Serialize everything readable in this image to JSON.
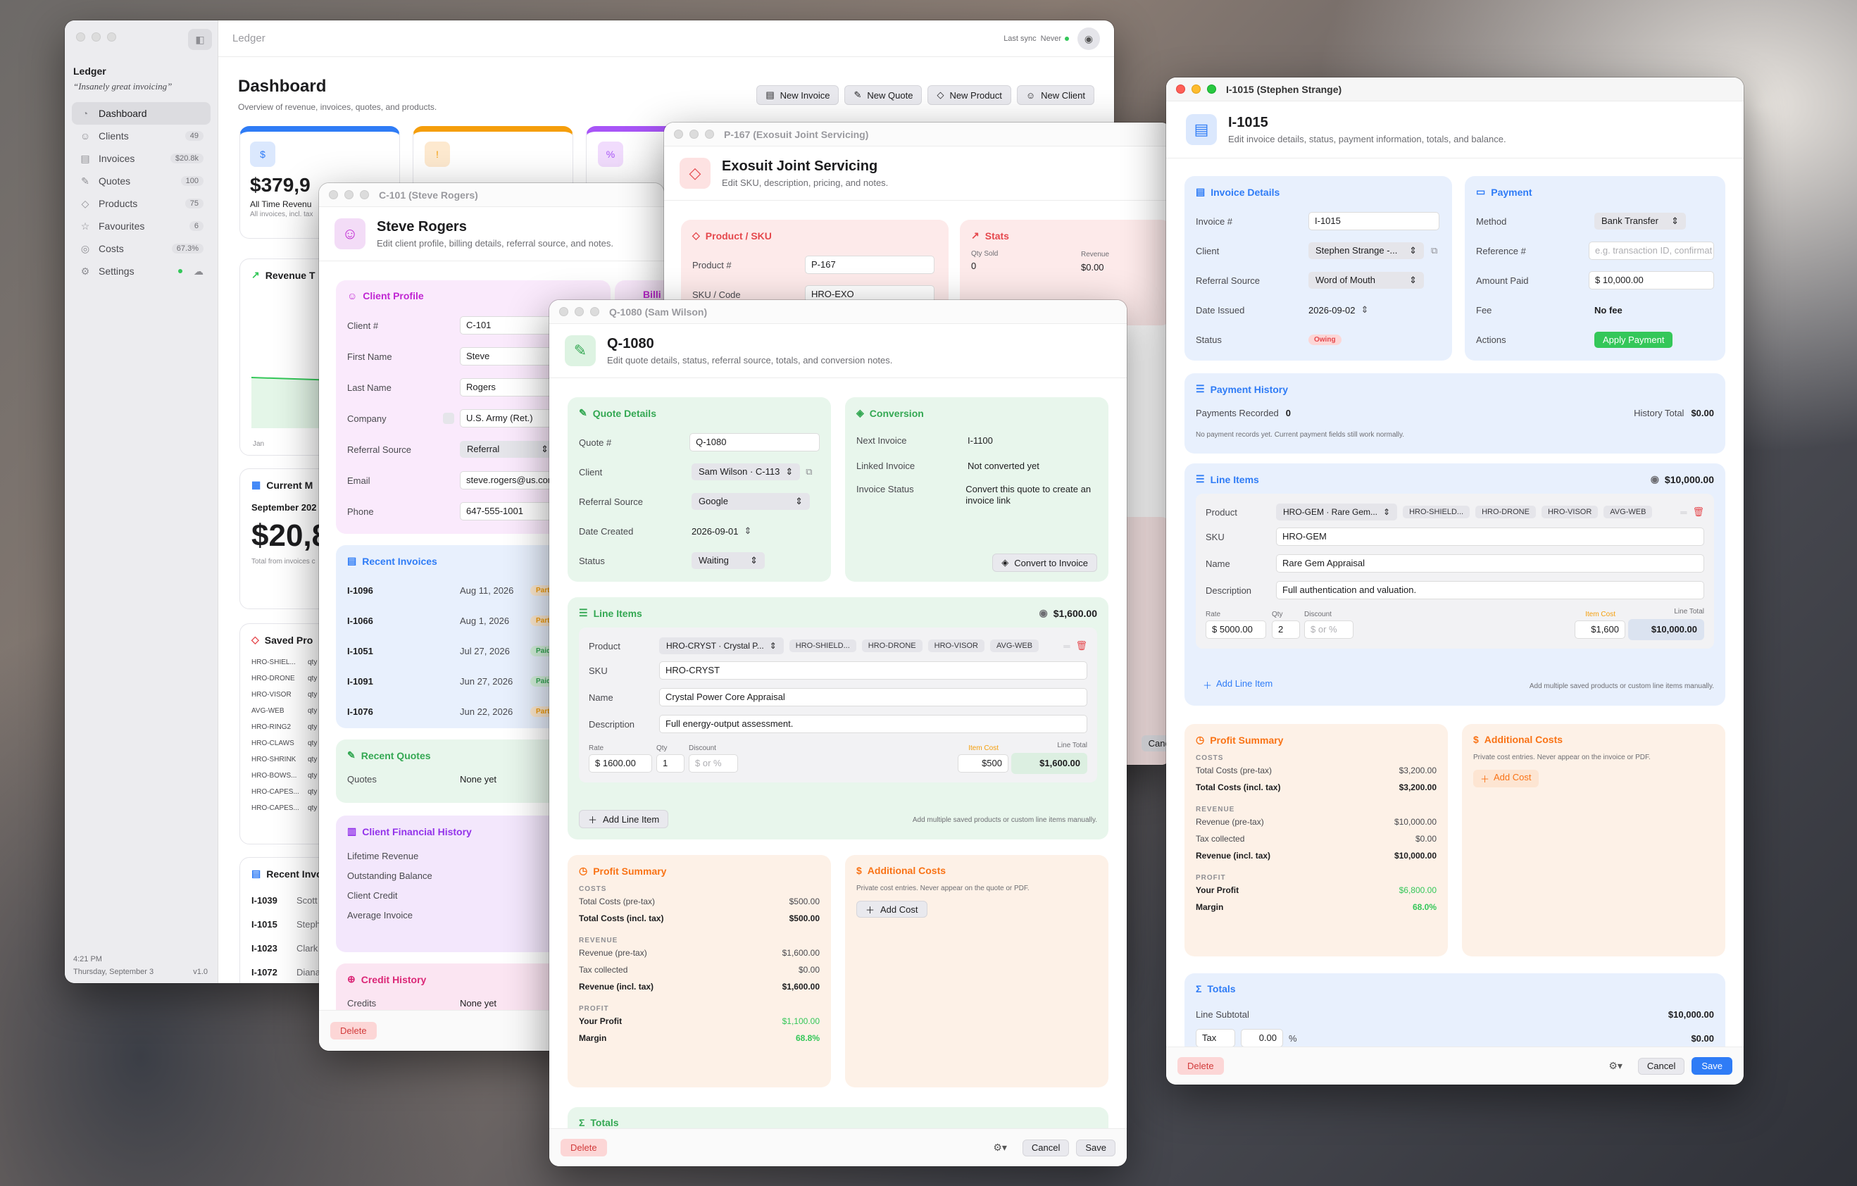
{
  "colors": {
    "accent": "#2f7cf6",
    "success": "#34c759",
    "danger": "#e5484d",
    "warning": "#f59e0b"
  },
  "dash": {
    "title_bar": "Ledger",
    "sync_label": "Last sync",
    "sync_value": "Never",
    "app_name": "Ledger",
    "tagline": "“Insanely great invoicing”",
    "nav": [
      {
        "label": "Dashboard",
        "icon": "gauge-icon",
        "count": ""
      },
      {
        "label": "Clients",
        "icon": "people-icon",
        "count": "49"
      },
      {
        "label": "Invoices",
        "icon": "document-icon",
        "count": "$20.8k"
      },
      {
        "label": "Quotes",
        "icon": "quote-icon",
        "count": "100"
      },
      {
        "label": "Products",
        "icon": "tag-icon",
        "count": "75"
      },
      {
        "label": "Favourites",
        "icon": "star-icon",
        "count": "6"
      },
      {
        "label": "Costs",
        "icon": "coins-icon",
        "count": "67.3%"
      },
      {
        "label": "Settings",
        "icon": "gear-icon",
        "count": ""
      }
    ],
    "time": "4:21 PM",
    "date": "Thursday, September 3",
    "version": "v1.0",
    "page_title": "Dashboard",
    "page_sub": "Overview of revenue, invoices, quotes, and products.",
    "actions": [
      "New Invoice",
      "New Quote",
      "New Product",
      "New Client"
    ],
    "stat_value": "$379,9",
    "stat_label": "All Time Revenu",
    "stat_note": "All invoices, incl. tax",
    "revenue_title": "Revenue T",
    "revenue_axis": "Jan",
    "current_title": "Current M",
    "current_month": "September 202",
    "current_value": "$20,8",
    "current_note": "Total from invoices c",
    "saved_title": "Saved Pro",
    "saved_items": [
      "HRO-SHIEL...",
      "HRO-DRONE",
      "HRO-VISOR",
      "AVG-WEB",
      "HRO-RING2",
      "HRO-CLAWS",
      "HRO-SHRINK",
      "HRO-BOWS...",
      "HRO-CAPES...",
      "HRO-CAPES..."
    ],
    "saved_qty": "qty",
    "recent_title": "Recent Invo",
    "recent": [
      {
        "id": "I-1039",
        "name": "Scott L"
      },
      {
        "id": "I-1015",
        "name": "Stephen"
      },
      {
        "id": "I-1023",
        "name": "Clark K"
      },
      {
        "id": "I-1072",
        "name": "Diana P"
      }
    ]
  },
  "client": {
    "title_bar": "C-101 (Steve Rogers)",
    "name": "Steve Rogers",
    "sub": "Edit client profile, billing details, referral source, and notes.",
    "profile_title": "Client Profile",
    "billing_peek": "Billi",
    "fields": [
      {
        "label": "Client #",
        "value": "C-101"
      },
      {
        "label": "First Name",
        "value": "Steve"
      },
      {
        "label": "Last Name",
        "value": "Rogers"
      },
      {
        "label": "Company",
        "value": "U.S. Army (Ret.)"
      },
      {
        "label": "Referral Source",
        "value": "Referral"
      },
      {
        "label": "Email",
        "value": "steve.rogers@us.com"
      },
      {
        "label": "Phone",
        "value": "647-555-1001"
      }
    ],
    "recent_invoices_title": "Recent Invoices",
    "invoices": [
      {
        "id": "I-1096",
        "date": "Aug 11, 2026",
        "status": "Partial"
      },
      {
        "id": "I-1066",
        "date": "Aug 1, 2026",
        "status": "Partial"
      },
      {
        "id": "I-1051",
        "date": "Jul 27, 2026",
        "status": "Paid"
      },
      {
        "id": "I-1091",
        "date": "Jun 27, 2026",
        "status": "Paid"
      },
      {
        "id": "I-1076",
        "date": "Jun 22, 2026",
        "status": "Partial"
      }
    ],
    "recent_quotes_title": "Recent Quotes",
    "quotes_label": "Quotes",
    "quotes_value": "None yet",
    "financial_title": "Client Financial History",
    "financial": [
      "Lifetime Revenue",
      "Outstanding Balance",
      "Client Credit",
      "Average Invoice"
    ],
    "financial_peek": "$",
    "credit_title": "Credit History",
    "credits_label": "Credits",
    "credits_value": "None yet",
    "delete": "Delete"
  },
  "product": {
    "title_bar": "P-167 (Exosuit Joint Servicing)",
    "name": "Exosuit Joint Servicing",
    "sub": "Edit SKU, description, pricing, and notes.",
    "sku_title": "Product / SKU",
    "product_label": "Product #",
    "product_value": "P-167",
    "sku_label": "SKU / Code",
    "sku_value": "HRO-EXO",
    "stats_title": "Stats",
    "qty_label": "Qty Sold",
    "qty_value": "0",
    "rev_label": "Revenue",
    "rev_value": "$0.00",
    "cancel_peek": "Canc"
  },
  "quote": {
    "title_bar": "Q-1080 (Sam Wilson)",
    "name": "Q-1080",
    "sub": "Edit quote details, status, referral source, totals, and conversion notes.",
    "details_title": "Quote Details",
    "quote_no_label": "Quote #",
    "quote_no": "Q-1080",
    "client_label": "Client",
    "client": "Sam Wilson · C-113",
    "ref_label": "Referral Source",
    "ref": "Google",
    "date_label": "Date Created",
    "date": "2026-09-01",
    "status_label": "Status",
    "status": "Waiting",
    "conv_title": "Conversion",
    "next_label": "Next Invoice",
    "next": "I-1100",
    "linked_label": "Linked Invoice",
    "linked": "Not converted yet",
    "inv_status_label": "Invoice Status",
    "inv_status": "Convert this quote to create an invoice link",
    "convert_btn": "Convert to Invoice",
    "line_title": "Line Items",
    "line_total": "$1,600.00",
    "product_label": "Product",
    "product": "HRO-CRYST · Crystal P...",
    "chips": [
      "HRO-SHIELD...",
      "HRO-DRONE",
      "HRO-VISOR",
      "AVG-WEB"
    ],
    "sku_label": "SKU",
    "sku": "HRO-CRYST",
    "name_label": "Name",
    "item_name": "Crystal Power Core Appraisal",
    "desc_label": "Description",
    "desc": "Full energy-output assessment.",
    "rate_label": "Rate",
    "rate": "1600.00",
    "qty_label": "Qty",
    "qty": "1",
    "disc_label": "Discount",
    "disc": "$ or %",
    "itemcost_label": "Item Cost",
    "itemcost": "$500",
    "linetotal_label": "Line Total",
    "linetotal": "$1,600.00",
    "add_line": "Add Line Item",
    "add_hint": "Add multiple saved products or custom line items manually.",
    "profit_title": "Profit Summary",
    "costs_sec": "COSTS",
    "tc_pre_label": "Total Costs (pre-tax)",
    "tc_pre": "$500.00",
    "tc_inc_label": "Total Costs (incl. tax)",
    "tc_inc": "$500.00",
    "rev_sec": "REVENUE",
    "rev_pre_label": "Revenue (pre-tax)",
    "rev_pre": "$1,600.00",
    "tax_label": "Tax collected",
    "tax": "$0.00",
    "rev_inc_label": "Revenue (incl. tax)",
    "rev_inc": "$1,600.00",
    "profit_sec": "PROFIT",
    "your_profit_label": "Your Profit",
    "your_profit": "$1,100.00",
    "margin_label": "Margin",
    "margin": "68.8%",
    "addl_title": "Additional Costs",
    "addl_note": "Private cost entries. Never appear on the quote or PDF.",
    "add_cost": "Add Cost",
    "totals_title": "Totals",
    "delete": "Delete",
    "cancel": "Cancel",
    "save": "Save"
  },
  "invoice": {
    "title_bar": "I-1015 (Stephen Strange)",
    "name": "I-1015",
    "sub": "Edit invoice details, status, payment information, totals, and balance.",
    "details_title": "Invoice Details",
    "inv_label": "Invoice #",
    "inv": "I-1015",
    "client_label": "Client",
    "client": "Stephen Strange -...",
    "ref_label": "Referral Source",
    "ref": "Word of Mouth",
    "date_label": "Date Issued",
    "date": "2026-09-02",
    "status_label": "Status",
    "status": "Owing",
    "pay_title": "Payment",
    "method_label": "Method",
    "method": "Bank Transfer",
    "refno_label": "Reference #",
    "refno_ph": "e.g. transaction ID, confirmat",
    "paid_label": "Amount Paid",
    "paid": "10,000.00",
    "fee_label": "Fee",
    "fee": "No fee",
    "actions_label": "Actions",
    "apply": "Apply Payment",
    "ph_title": "Payment History",
    "recorded_label": "Payments Recorded",
    "recorded": "0",
    "hist_label": "History Total",
    "hist": "$0.00",
    "ph_note": "No payment records yet. Current payment fields still work normally.",
    "line_title": "Line Items",
    "line_total": "$10,000.00",
    "product_label": "Product",
    "product": "HRO-GEM · Rare Gem...",
    "chips": [
      "HRO-SHIELD...",
      "HRO-DRONE",
      "HRO-VISOR",
      "AVG-WEB"
    ],
    "sku_label": "SKU",
    "sku": "HRO-GEM",
    "name_label": "Name",
    "item_name": "Rare Gem Appraisal",
    "desc_label": "Description",
    "desc": "Full authentication and valuation.",
    "rate_label": "Rate",
    "rate": "5000.00",
    "qty_label": "Qty",
    "qty": "2",
    "disc_label": "Discount",
    "disc": "$ or %",
    "itemcost_label": "Item Cost",
    "itemcost": "$1,600",
    "linetotal_label": "Line Total",
    "linetotal": "$10,000.00",
    "add_line": "Add Line Item",
    "add_hint": "Add multiple saved products or custom line items manually.",
    "profit_title": "Profit Summary",
    "costs_sec": "COSTS",
    "tc_pre_label": "Total Costs (pre-tax)",
    "tc_pre": "$3,200.00",
    "tc_inc_label": "Total Costs (incl. tax)",
    "tc_inc": "$3,200.00",
    "rev_sec": "REVENUE",
    "rev_pre_label": "Revenue (pre-tax)",
    "rev_pre": "$10,000.00",
    "tax_label": "Tax collected",
    "tax": "$0.00",
    "rev_inc_label": "Revenue (incl. tax)",
    "rev_inc": "$10,000.00",
    "profit_sec": "PROFIT",
    "your_profit_label": "Your Profit",
    "your_profit": "$6,800.00",
    "margin_label": "Margin",
    "margin": "68.0%",
    "addl_title": "Additional Costs",
    "addl_note": "Private cost entries. Never appear on the invoice or PDF.",
    "add_cost": "Add Cost",
    "totals_title": "Totals",
    "subtotal_label": "Line Subtotal",
    "subtotal": "$10,000.00",
    "tax_field_label": "Tax",
    "tax_field": "0.00",
    "tax_unit": "%",
    "tax_amount": "$0.00",
    "delete": "Delete",
    "cancel": "Cancel",
    "save": "Save"
  }
}
